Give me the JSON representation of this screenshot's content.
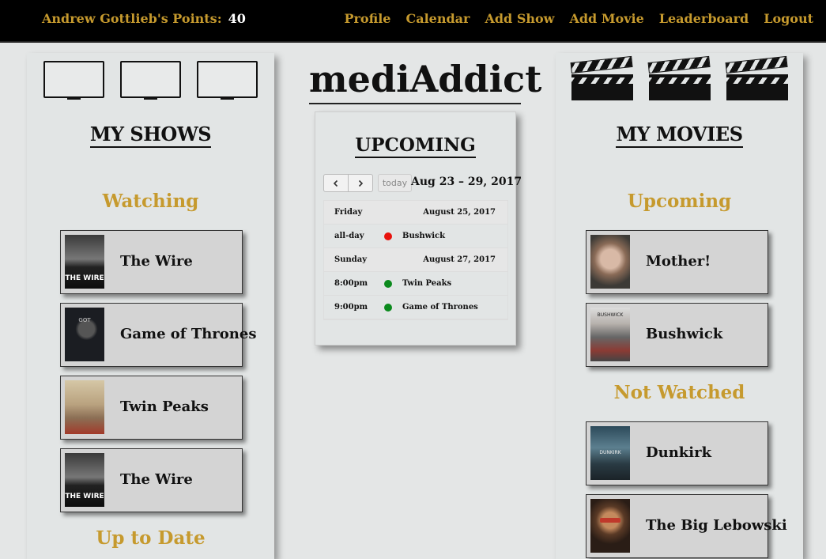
{
  "nav": {
    "points_label": "Andrew Gottlieb's Points:",
    "points_value": "40",
    "links": [
      "Profile",
      "Calendar",
      "Add Show",
      "Add Movie",
      "Leaderboard",
      "Logout"
    ]
  },
  "logo": "mediAddict",
  "shows": {
    "title": "MY SHOWS",
    "watching_title": "Watching",
    "items": [
      "The Wire",
      "Game of Thrones",
      "Twin Peaks",
      "The Wire"
    ],
    "up_to_date_title": "Up to Date"
  },
  "upcoming": {
    "title": "UPCOMING",
    "prev_icon": "chevron-left-icon",
    "next_icon": "chevron-right-icon",
    "today_label": "today",
    "range": "Aug 23 – 29, 2017",
    "days": [
      {
        "name": "Friday",
        "date": "August 25, 2017",
        "events": [
          {
            "time": "all-day",
            "name": "Bushwick",
            "color": "#e8120c"
          }
        ]
      },
      {
        "name": "Sunday",
        "date": "August 27, 2017",
        "events": [
          {
            "time": "8:00pm",
            "name": "Twin Peaks",
            "color": "#0b8a1d"
          },
          {
            "time": "9:00pm",
            "name": "Game of Thrones",
            "color": "#0b8a1d"
          }
        ]
      }
    ]
  },
  "movies": {
    "title": "MY MOVIES",
    "upcoming_title": "Upcoming",
    "upcoming_items": [
      "Mother!",
      "Bushwick"
    ],
    "not_watched_title": "Not Watched",
    "not_watched_items": [
      "Dunkirk",
      "The Big Lebowski"
    ]
  },
  "colors": {
    "accent": "#c69a2e",
    "nav_bg": "#000000",
    "panel_bg": "#e2e5e5"
  }
}
